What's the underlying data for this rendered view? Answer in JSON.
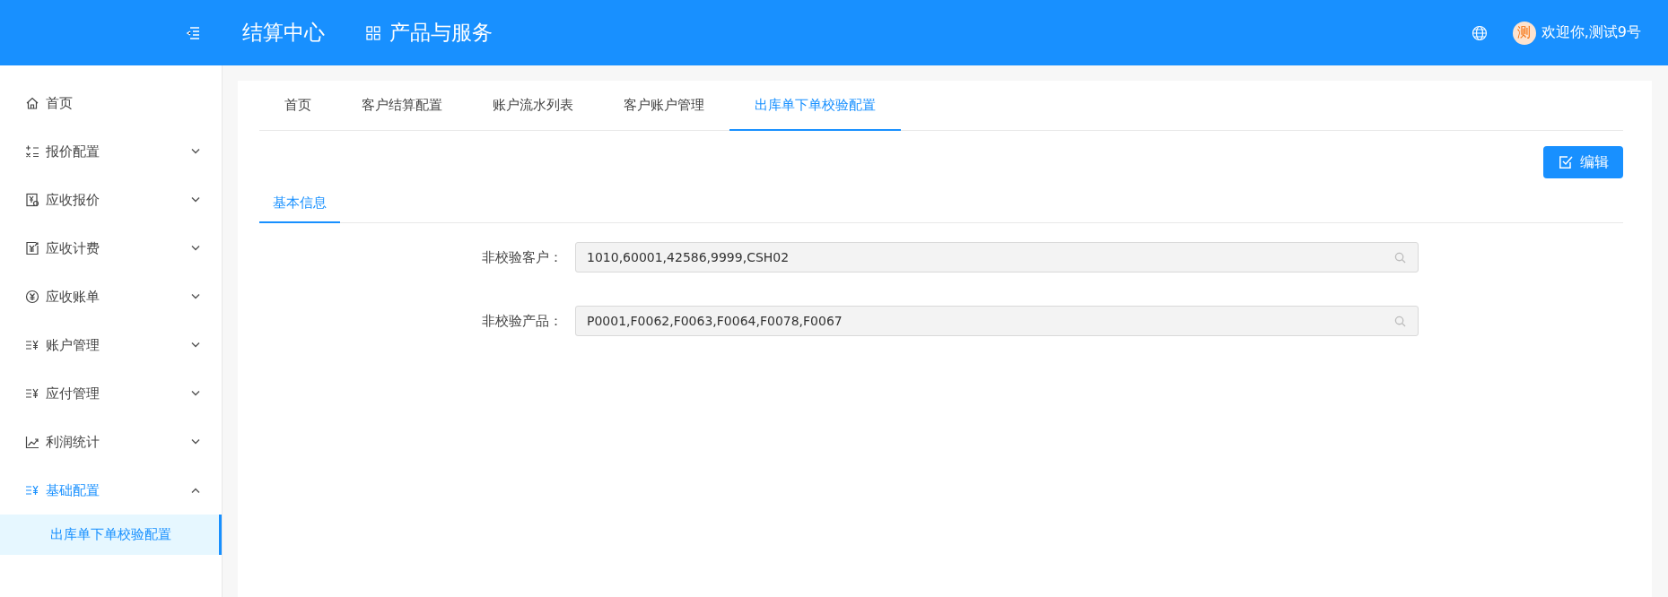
{
  "header": {
    "title": "结算中心",
    "nav_label": "产品与服务",
    "user_avatar": "测",
    "user_greeting": "欢迎你,测试9号"
  },
  "sidebar": {
    "items": [
      {
        "label": "首页",
        "expandable": false,
        "selected": false
      },
      {
        "label": "报价配置",
        "expandable": true,
        "expanded": false,
        "selected": false
      },
      {
        "label": "应收报价",
        "expandable": true,
        "expanded": false,
        "selected": false
      },
      {
        "label": "应收计费",
        "expandable": true,
        "expanded": false,
        "selected": false
      },
      {
        "label": "应收账单",
        "expandable": true,
        "expanded": false,
        "selected": false
      },
      {
        "label": "账户管理",
        "expandable": true,
        "expanded": false,
        "selected": false
      },
      {
        "label": "应付管理",
        "expandable": true,
        "expanded": false,
        "selected": false
      },
      {
        "label": "利润统计",
        "expandable": true,
        "expanded": false,
        "selected": false
      },
      {
        "label": "基础配置",
        "expandable": true,
        "expanded": true,
        "selected": true,
        "children": [
          {
            "label": "出库单下单校验配置",
            "selected": true
          }
        ]
      }
    ]
  },
  "tabs": [
    {
      "label": "首页",
      "selected": false
    },
    {
      "label": "客户结算配置",
      "selected": false
    },
    {
      "label": "账户流水列表",
      "selected": false
    },
    {
      "label": "客户账户管理",
      "selected": false
    },
    {
      "label": "出库单下单校验配置",
      "selected": true
    }
  ],
  "edit_button": "编辑",
  "sub_tabs": [
    {
      "label": "基本信息",
      "selected": true
    }
  ],
  "form": [
    {
      "label": "非校验客户：",
      "value": "1010,60001,42586,9999,CSH02"
    },
    {
      "label": "非校验产品：",
      "value": "P0001,F0062,F0063,F0064,F0078,F0067"
    }
  ]
}
